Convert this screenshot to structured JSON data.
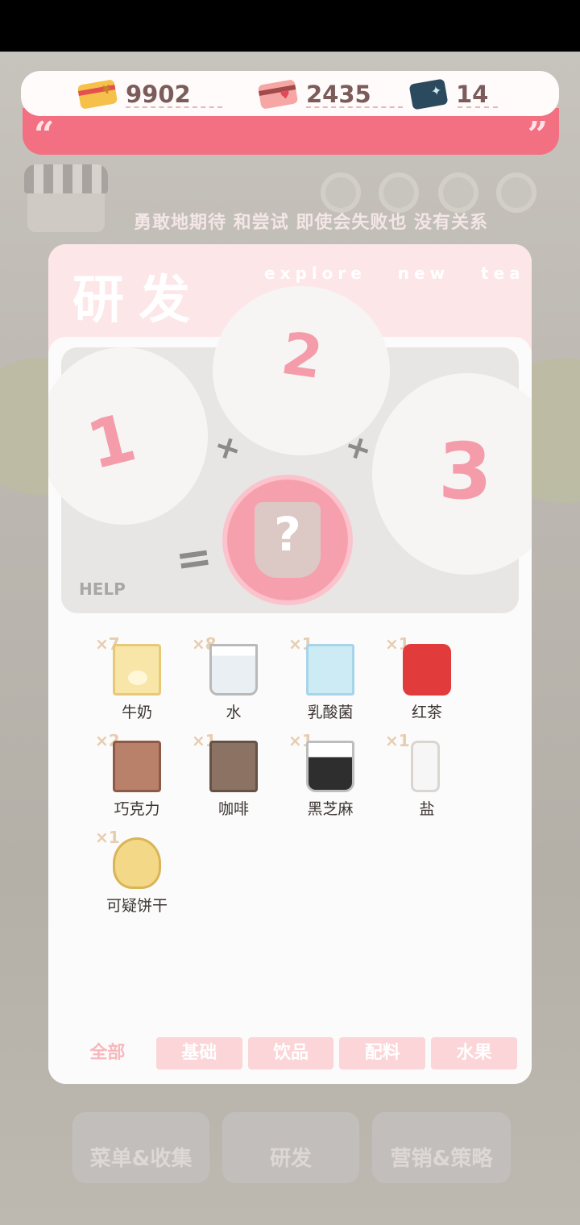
{
  "currencies": [
    {
      "name": "gold-card",
      "value": "9902"
    },
    {
      "name": "pink-card",
      "value": "2435"
    },
    {
      "name": "star-card",
      "value": "14"
    }
  ],
  "quote": {
    "open": "“",
    "close": "”"
  },
  "slogan": "勇敢地期待 和尝试  即使会失败也 没有关系",
  "panel": {
    "title": "研发",
    "subtitle": "explore new tea",
    "slots": [
      "1",
      "2",
      "3"
    ],
    "result_symbol": "?",
    "help_label": "HELP"
  },
  "ingredients": [
    {
      "name": "牛奶",
      "count": "×7",
      "icon": "milk-carton-icon"
    },
    {
      "name": "水",
      "count": "×8",
      "icon": "water-jug-icon"
    },
    {
      "name": "乳酸菌",
      "count": "×1",
      "icon": "lacto-carton-icon"
    },
    {
      "name": "红茶",
      "count": "×1",
      "icon": "black-tea-tin-icon"
    },
    {
      "name": "巧克力",
      "count": "×2",
      "icon": "chocolate-bag-icon"
    },
    {
      "name": "咖啡",
      "count": "×1",
      "icon": "coffee-bag-icon"
    },
    {
      "name": "黑芝麻",
      "count": "×1",
      "icon": "sesame-jar-icon"
    },
    {
      "name": "盐",
      "count": "×1",
      "icon": "salt-shaker-icon"
    },
    {
      "name": "可疑饼干",
      "count": "×1",
      "icon": "fortune-cookie-icon"
    }
  ],
  "tabs": [
    {
      "label": "全部",
      "active": true
    },
    {
      "label": "基础",
      "active": false
    },
    {
      "label": "饮品",
      "active": false
    },
    {
      "label": "配料",
      "active": false
    },
    {
      "label": "水果",
      "active": false
    }
  ],
  "bottom_nav": [
    "菜单&收集",
    "研发",
    "营销&策略"
  ],
  "colors": {
    "accent": "#f36f82",
    "panel_head": "#fde6e8",
    "tab": "#fbd5d7",
    "slot_number": "#f59caa"
  }
}
